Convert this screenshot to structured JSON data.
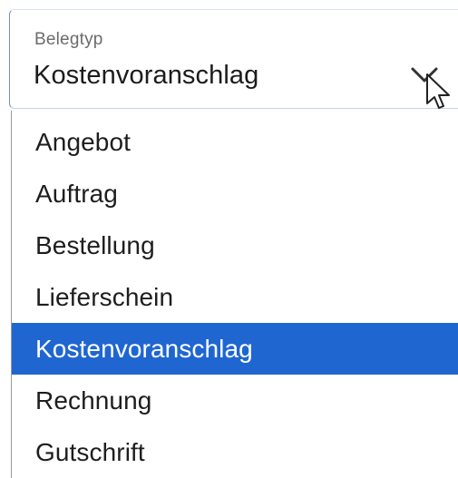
{
  "field": {
    "label": "Belegtyp",
    "value": "Kostenvoranschlag",
    "chevron_icon": "chevron-down-icon",
    "cursor_icon": "mouse-pointer-icon"
  },
  "options": [
    {
      "label": "Angebot",
      "selected": false
    },
    {
      "label": "Auftrag",
      "selected": false
    },
    {
      "label": "Bestellung",
      "selected": false
    },
    {
      "label": "Lieferschein",
      "selected": false
    },
    {
      "label": "Kostenvoranschlag",
      "selected": true
    },
    {
      "label": "Rechnung",
      "selected": false
    },
    {
      "label": "Gutschrift",
      "selected": false
    }
  ],
  "colors": {
    "selected_bg": "#1f66d1",
    "selected_text": "#ffffff",
    "text": "#1e1e1e",
    "label_text": "#6b6b6b",
    "field_border": "#6f8fbf"
  }
}
